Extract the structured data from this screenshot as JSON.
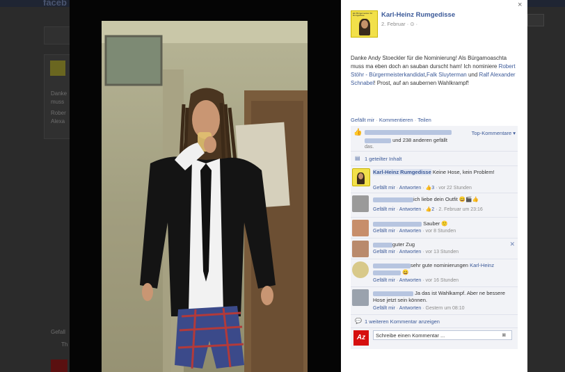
{
  "background": {
    "logo": "faceb",
    "card_text": [
      "Danke",
      "muss",
      "Rober",
      "Alexa"
    ],
    "footer_text": [
      "Gefall",
      "Th"
    ]
  },
  "post": {
    "author": "Karl-Heinz Rumgedisse",
    "date": "2. Februar",
    "meta_icons": "· ⊙ ·",
    "text_part1": "Danke Andy Stoeckler für die Nominierung! Als Bürgamoaschta muss ma eben doch an sauban durscht ham! Ich nominiere ",
    "mention1": "Robert Stöhr - Bürgermeisterkandidat",
    "text_sep": ",",
    "mention2": "Falk Sluyterman",
    "text_and": " und ",
    "mention3": "Ralf Alexander Schnabel",
    "text_part2": "! Prost, auf an saubernen Wahlkrampf!",
    "actions": [
      "Gefällt mir",
      "Kommentieren",
      "Teilen"
    ],
    "close": "×"
  },
  "ufi": {
    "top_comments": "Top-Kommentare ▾",
    "likes_suffix": "und 238 anderen gefällt",
    "likes_suffix2": "das.",
    "shared": "1 geteilter Inhalt",
    "view_more": "1 weiteren Kommentar anzeigen",
    "input_placeholder": "Schreibe einen Kommentar ...",
    "camera_icon": "camera-icon",
    "like_label": "Gefällt mir",
    "reply_label": "Antworten"
  },
  "comments": [
    {
      "author": "Karl-Heinz Rumgedisse",
      "text": "Keine Hose, kein Problem!",
      "likes": "3",
      "time": "vor 22 Stunden"
    },
    {
      "author": "",
      "text": "ich liebe dein Outfit 😄🎬👍",
      "likes": "2",
      "time": "2. Februar um 23:16"
    },
    {
      "author": "",
      "text": "Sauber 🙂",
      "likes": "",
      "time": "vor 8 Stunden"
    },
    {
      "author": "",
      "text": "guter Zug",
      "likes": "",
      "time": "vor 13 Stunden"
    },
    {
      "author": "",
      "text": "sehr gute nominierungen ",
      "mention": "Karl-Heinz",
      "text2": " 😄",
      "likes": "",
      "time": "vor 16 Stunden"
    },
    {
      "author": "",
      "text": "Ja das ist Wahlkampf. Aber ne bessere Hose jetzt sein können.",
      "likes": "",
      "time": "Gestern um 08:10"
    }
  ],
  "colors": {
    "link": "#3b5998",
    "panel_bg": "#ffffff",
    "ufi_bg": "#f2f3f7",
    "overlay": "#050505"
  }
}
